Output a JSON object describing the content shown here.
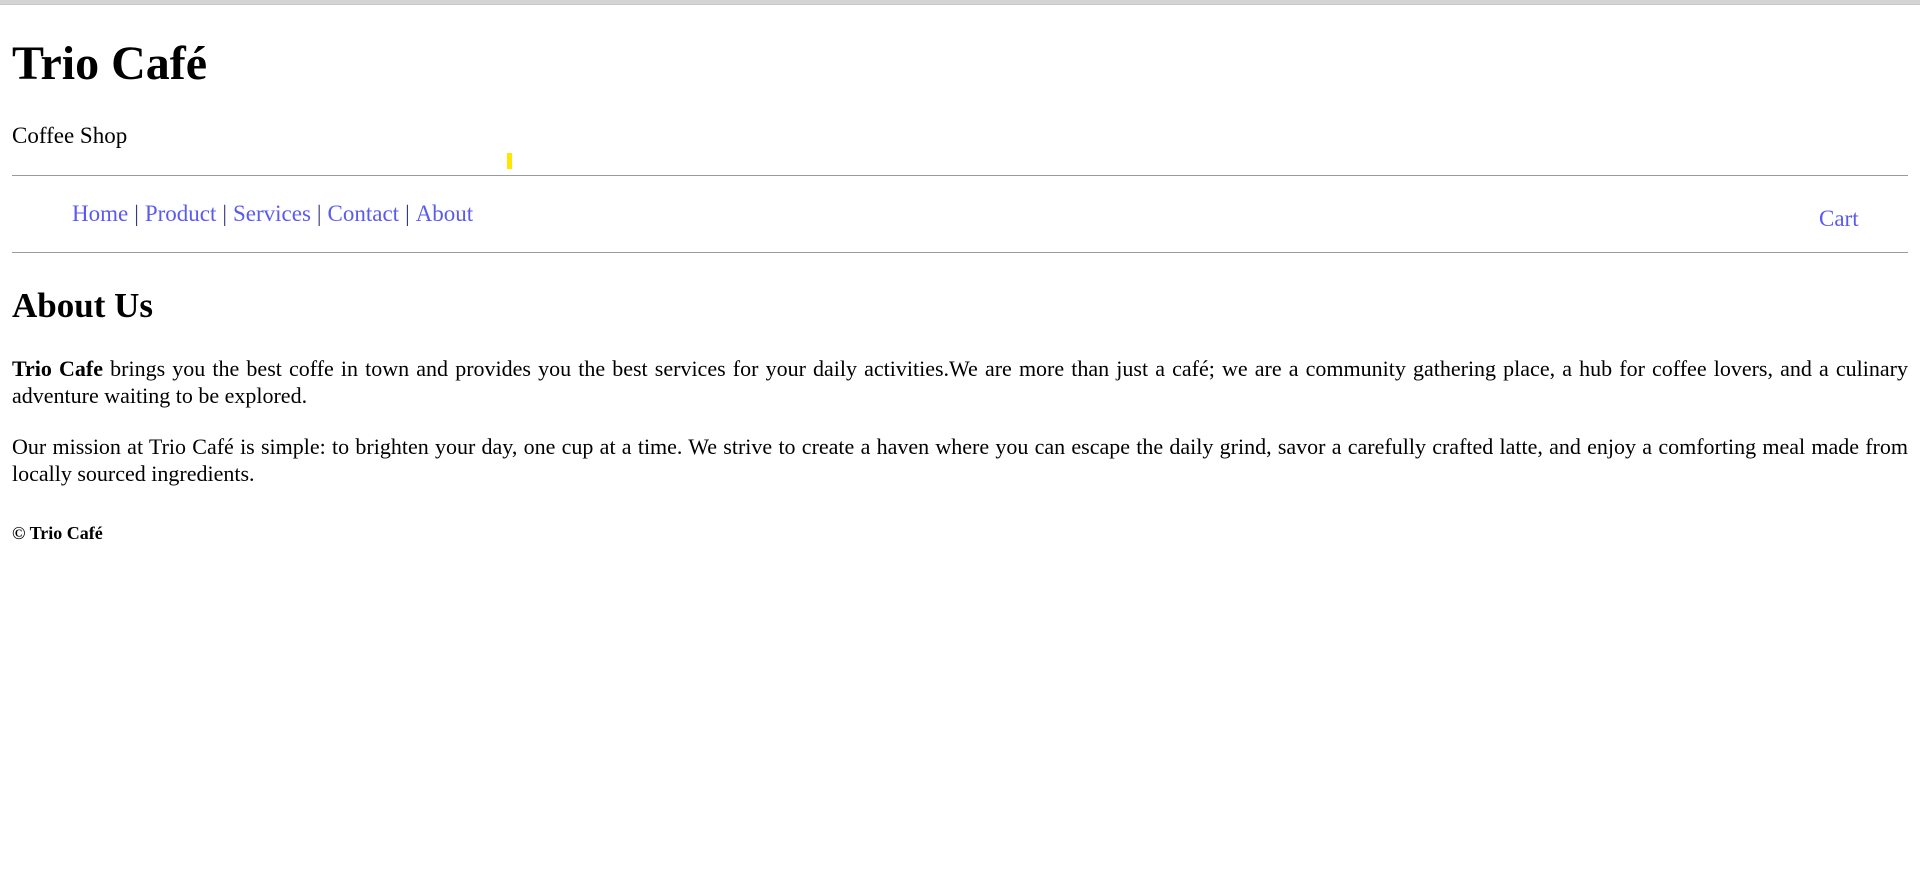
{
  "header": {
    "title": "Trio Café",
    "subtitle": "Coffee Shop"
  },
  "nav": {
    "items": [
      {
        "label": "Home"
      },
      {
        "label": "Product"
      },
      {
        "label": "Services"
      },
      {
        "label": "Contact"
      },
      {
        "label": "About"
      }
    ],
    "separator": "|",
    "cart_label": "Cart"
  },
  "main": {
    "heading": "About Us",
    "para1_bold": "Trio Cafe",
    "para1_rest": " brings you the best coffe in town and provides you the best services for your daily activities.We are more than just a café; we are a community gathering place, a hub for coffee lovers, and a culinary adventure waiting to be explored.",
    "para2": "Our mission at Trio Café is simple: to brighten your day, one cup at a time. We strive to create a haven where you can escape the daily grind, savor a carefully crafted latte, and enjoy a comforting meal made from locally sourced ingredients."
  },
  "footer": {
    "text": "© Trio Café"
  },
  "colors": {
    "link": "#5a5af0",
    "cursor_marker": "#ffe600",
    "rule": "#9b9b9b"
  }
}
